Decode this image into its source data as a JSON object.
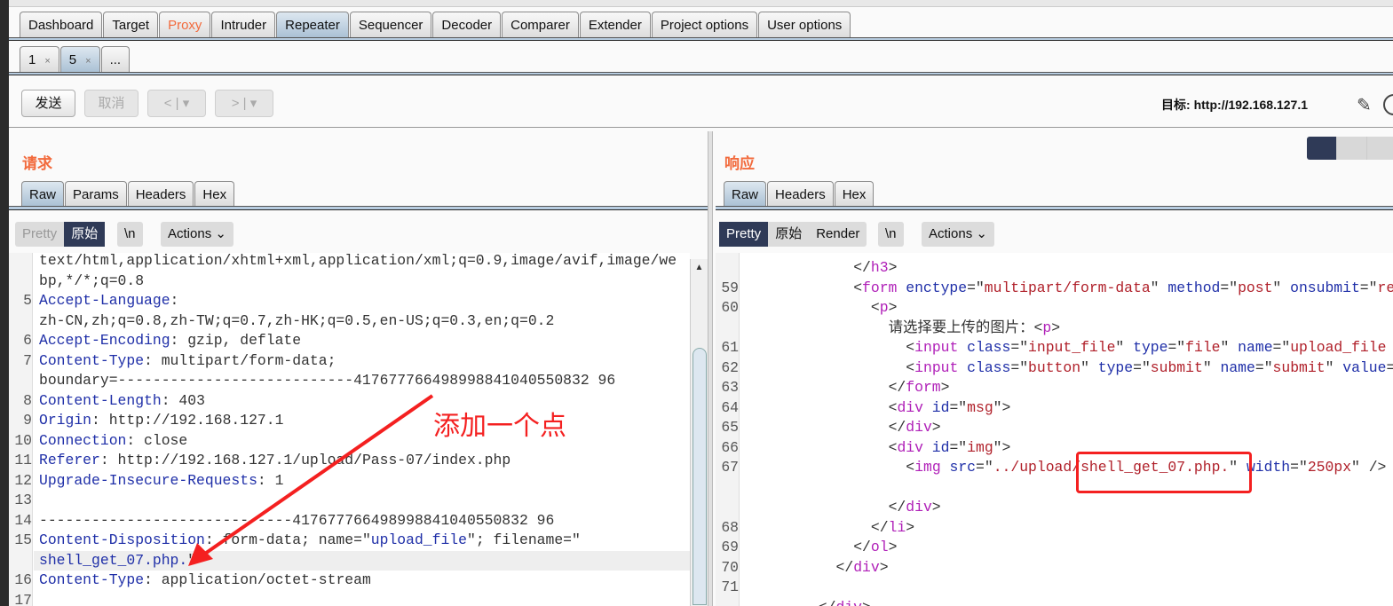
{
  "main_tabs": [
    "Dashboard",
    "Target",
    "Proxy",
    "Intruder",
    "Repeater",
    "Sequencer",
    "Decoder",
    "Comparer",
    "Extender",
    "Project options",
    "User options"
  ],
  "active_main_tab": "Repeater",
  "sub_tabs": [
    {
      "label": "1",
      "close": "×"
    },
    {
      "label": "5",
      "close": "×"
    },
    {
      "label": "..."
    }
  ],
  "toolbar": {
    "send": "发送",
    "cancel": "取消",
    "back": "<",
    "back_drop": "▾",
    "forward": ">",
    "forward_drop": "▾",
    "target_label": "目标: http://192.168.127.1"
  },
  "request": {
    "title": "请求",
    "tabs": [
      "Raw",
      "Params",
      "Headers",
      "Hex"
    ],
    "view": {
      "pretty": "Pretty",
      "raw": "原始",
      "newline": "\\n",
      "actions": "Actions ⌄"
    },
    "lines": [
      {
        "n": "",
        "s": [
          [
            "p",
            "text/html,application/xhtml+xml,application/xml;q=0.9,image/avif,image/we"
          ]
        ]
      },
      {
        "n": "",
        "s": [
          [
            "p",
            "bp,*/*;q=0.8"
          ]
        ]
      },
      {
        "n": "5",
        "s": [
          [
            "k",
            "Accept-Language"
          ],
          [
            "p",
            ":"
          ]
        ]
      },
      {
        "n": "",
        "s": [
          [
            "p",
            "zh-CN,zh;q=0.8,zh-TW;q=0.7,zh-HK;q=0.5,en-US;q=0.3,en;q=0.2"
          ]
        ]
      },
      {
        "n": "6",
        "s": [
          [
            "k",
            "Accept-Encoding"
          ],
          [
            "p",
            ": gzip, deflate"
          ]
        ]
      },
      {
        "n": "7",
        "s": [
          [
            "k",
            "Content-Type"
          ],
          [
            "p",
            ": multipart/form-data;"
          ]
        ]
      },
      {
        "n": "",
        "s": [
          [
            "p",
            "boundary=---------------------------417677766498998841040550832 96"
          ]
        ]
      },
      {
        "n": "8",
        "s": [
          [
            "k",
            "Content-Length"
          ],
          [
            "p",
            ": 403"
          ]
        ]
      },
      {
        "n": "9",
        "s": [
          [
            "k",
            "Origin"
          ],
          [
            "p",
            ": http://192.168.127.1"
          ]
        ]
      },
      {
        "n": "10",
        "s": [
          [
            "k",
            "Connection"
          ],
          [
            "p",
            ": close"
          ]
        ]
      },
      {
        "n": "11",
        "s": [
          [
            "k",
            "Referer"
          ],
          [
            "p",
            ": http://192.168.127.1/upload/Pass-07/index.php"
          ]
        ]
      },
      {
        "n": "12",
        "s": [
          [
            "k",
            "Upgrade-Insecure-Requests"
          ],
          [
            "p",
            ": 1"
          ]
        ]
      },
      {
        "n": "13",
        "s": []
      },
      {
        "n": "14",
        "s": [
          [
            "p",
            "-----------------------------417677766498998841040550832 96"
          ]
        ]
      },
      {
        "n": "15",
        "s": [
          [
            "k",
            "Content-Disposition"
          ],
          [
            "p",
            ": form-data; name=\""
          ],
          [
            "b",
            "upload_file"
          ],
          [
            "p",
            "\"; filename=\""
          ]
        ]
      },
      {
        "n": "",
        "s": [
          [
            "b",
            "shell_get_07.php."
          ],
          [
            "p",
            "\""
          ]
        ],
        "highlight": true
      },
      {
        "n": "16",
        "s": [
          [
            "k",
            "Content-Type"
          ],
          [
            "p",
            ": application/octet-stream"
          ]
        ]
      },
      {
        "n": "17",
        "s": []
      }
    ]
  },
  "response": {
    "title": "响应",
    "tabs": [
      "Raw",
      "Headers",
      "Hex"
    ],
    "view": {
      "pretty": "Pretty",
      "raw": "原始",
      "render": "Render",
      "newline": "\\n",
      "actions": "Actions ⌄"
    },
    "lines": [
      {
        "n": "",
        "i": 6,
        "s": [
          [
            "p",
            "</"
          ],
          [
            "t",
            "h3"
          ],
          [
            "p",
            ">"
          ]
        ]
      },
      {
        "n": "59",
        "i": 6,
        "s": [
          [
            "p",
            "<"
          ],
          [
            "t",
            "form"
          ],
          [
            "a",
            " enctype"
          ],
          [
            "p",
            "=\""
          ],
          [
            "v",
            "multipart/form-data"
          ],
          [
            "p",
            "\""
          ],
          [
            "a",
            " method"
          ],
          [
            "p",
            "=\""
          ],
          [
            "v",
            "post"
          ],
          [
            "p",
            "\""
          ],
          [
            "a",
            " onsubmit"
          ],
          [
            "p",
            "=\""
          ],
          [
            "v",
            "re"
          ]
        ]
      },
      {
        "n": "60",
        "i": 7,
        "s": [
          [
            "p",
            "<"
          ],
          [
            "t",
            "p"
          ],
          [
            "p",
            ">"
          ]
        ]
      },
      {
        "n": "",
        "i": 8,
        "s": [
          [
            "p",
            "请选择要上传的图片：<"
          ],
          [
            "t",
            "p"
          ],
          [
            "p",
            ">"
          ]
        ]
      },
      {
        "n": "61",
        "i": 9,
        "s": [
          [
            "p",
            "<"
          ],
          [
            "t",
            "input"
          ],
          [
            "a",
            " class"
          ],
          [
            "p",
            "=\""
          ],
          [
            "v",
            "input_file"
          ],
          [
            "p",
            "\""
          ],
          [
            "a",
            " type"
          ],
          [
            "p",
            "=\""
          ],
          [
            "v",
            "file"
          ],
          [
            "p",
            "\""
          ],
          [
            "a",
            " name"
          ],
          [
            "p",
            "=\""
          ],
          [
            "v",
            "upload_file"
          ]
        ]
      },
      {
        "n": "62",
        "i": 9,
        "s": [
          [
            "p",
            "<"
          ],
          [
            "t",
            "input"
          ],
          [
            "a",
            " class"
          ],
          [
            "p",
            "=\""
          ],
          [
            "v",
            "button"
          ],
          [
            "p",
            "\""
          ],
          [
            "a",
            " type"
          ],
          [
            "p",
            "=\""
          ],
          [
            "v",
            "submit"
          ],
          [
            "p",
            "\""
          ],
          [
            "a",
            " name"
          ],
          [
            "p",
            "=\""
          ],
          [
            "v",
            "submit"
          ],
          [
            "p",
            "\""
          ],
          [
            "a",
            " value"
          ],
          [
            "p",
            "="
          ]
        ]
      },
      {
        "n": "63",
        "i": 8,
        "s": [
          [
            "p",
            "</"
          ],
          [
            "t",
            "form"
          ],
          [
            "p",
            ">"
          ]
        ]
      },
      {
        "n": "64",
        "i": 8,
        "s": [
          [
            "p",
            "<"
          ],
          [
            "t",
            "div"
          ],
          [
            "a",
            " id"
          ],
          [
            "p",
            "=\""
          ],
          [
            "v",
            "msg"
          ],
          [
            "p",
            "\">"
          ]
        ]
      },
      {
        "n": "65",
        "i": 8,
        "s": [
          [
            "p",
            "</"
          ],
          [
            "t",
            "div"
          ],
          [
            "p",
            ">"
          ]
        ]
      },
      {
        "n": "66",
        "i": 8,
        "s": [
          [
            "p",
            "<"
          ],
          [
            "t",
            "div"
          ],
          [
            "a",
            " id"
          ],
          [
            "p",
            "=\""
          ],
          [
            "v",
            "img"
          ],
          [
            "p",
            "\">"
          ]
        ]
      },
      {
        "n": "67",
        "i": 9,
        "s": [
          [
            "p",
            "<"
          ],
          [
            "t",
            "img"
          ],
          [
            "a",
            " src"
          ],
          [
            "p",
            "=\""
          ],
          [
            "v",
            "../upload/shell_get_07.php."
          ],
          [
            "p",
            "\""
          ],
          [
            "a",
            " width"
          ],
          [
            "p",
            "=\""
          ],
          [
            "v",
            "250px"
          ],
          [
            "p",
            "\" />"
          ]
        ]
      },
      {
        "n": "",
        "i": 8,
        "s": []
      },
      {
        "n": "",
        "i": 8,
        "s": [
          [
            "p",
            "</"
          ],
          [
            "t",
            "div"
          ],
          [
            "p",
            ">"
          ]
        ]
      },
      {
        "n": "68",
        "i": 7,
        "s": [
          [
            "p",
            "</"
          ],
          [
            "t",
            "li"
          ],
          [
            "p",
            ">"
          ]
        ]
      },
      {
        "n": "69",
        "i": 6,
        "s": [
          [
            "p",
            "</"
          ],
          [
            "t",
            "ol"
          ],
          [
            "p",
            ">"
          ]
        ]
      },
      {
        "n": "70",
        "i": 5,
        "s": [
          [
            "p",
            "</"
          ],
          [
            "t",
            "div"
          ],
          [
            "p",
            ">"
          ]
        ]
      },
      {
        "n": "71",
        "i": 0,
        "s": []
      },
      {
        "n": "",
        "i": 4,
        "s": [
          [
            "p",
            "</"
          ],
          [
            "t",
            "div"
          ],
          [
            "p",
            ">"
          ]
        ]
      }
    ]
  },
  "annotation": "添加一个点",
  "colors": {
    "accent": "#f26a3c",
    "annotation": "#f42020",
    "dark": "#2f3a57"
  }
}
